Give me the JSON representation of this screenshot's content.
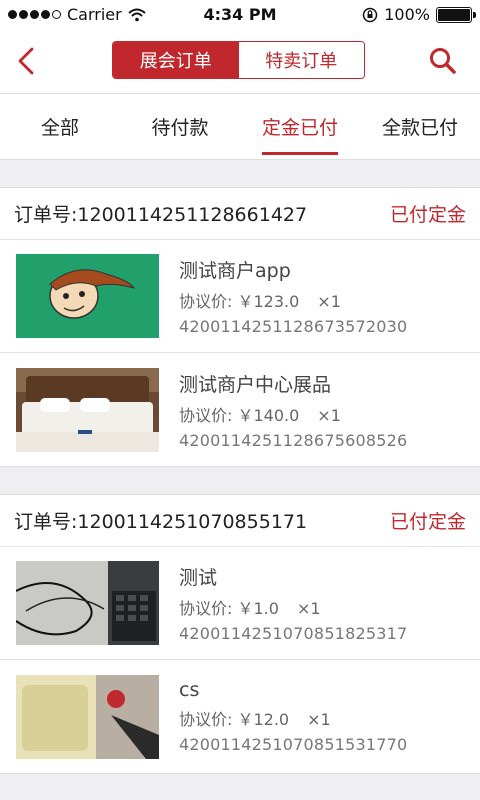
{
  "status_bar": {
    "carrier": "Carrier",
    "time": "4:34 PM",
    "battery": "100%"
  },
  "nav": {
    "segments": [
      "展会订单",
      "特卖订单"
    ],
    "active_segment": 0
  },
  "tabs": [
    {
      "label": "全部"
    },
    {
      "label": "待付款"
    },
    {
      "label": "定金已付"
    },
    {
      "label": "全款已付"
    }
  ],
  "active_tab": 2,
  "orders": [
    {
      "order_no": "订单号:12001142511286614​27",
      "status": "已付定金",
      "items": [
        {
          "name": "测试商户app",
          "price": "协议价: ￥123.0",
          "qty": "×1",
          "sku": "420011425112867357203O"
        },
        {
          "name": "测试商户中心展品",
          "price": "协议价: ￥140.0",
          "qty": "×1",
          "sku": "420011425112867560852​6"
        }
      ]
    },
    {
      "order_no": "订单号:1200114251070855171",
      "status": "已付定金",
      "items": [
        {
          "name": "测试",
          "price": "协议价: ￥1.0",
          "qty": "×1",
          "sku": "4200114251070851825317"
        },
        {
          "name": "cs",
          "price": "协议价: ￥12.0",
          "qty": "×1",
          "sku": "4200114251070851531770"
        }
      ]
    }
  ],
  "colors": {
    "accent": "#c0282d"
  }
}
